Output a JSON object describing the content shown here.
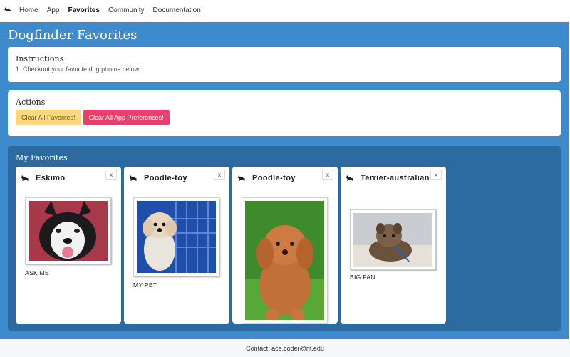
{
  "nav": {
    "logo_icon": "dog-icon",
    "links": [
      "Home",
      "App",
      "Favorites",
      "Community",
      "Documentation"
    ],
    "active": "Favorites"
  },
  "page": {
    "title": "Dogfinder Favorites"
  },
  "instructions": {
    "title": "Instructions",
    "items": [
      "1. Checkout your favorite dog photos below!"
    ]
  },
  "actions": {
    "title": "Actions",
    "clear_favorites": "Clear All Favorites!",
    "clear_preferences": "Clear All App Preferences!"
  },
  "favorites": {
    "title": "My Favorites",
    "close_label": "x",
    "cards": [
      {
        "name": "Eskimo",
        "caption": "ASK ME",
        "icon": "dog-icon"
      },
      {
        "name": "Poodle-toy",
        "caption": "MY PET",
        "icon": "dog-icon"
      },
      {
        "name": "Poodle-toy",
        "caption": "",
        "icon": "dog-icon"
      },
      {
        "name": "Terrier-australian",
        "caption": "BIG FAN",
        "icon": "dog-icon"
      }
    ]
  },
  "footer": {
    "contact": "Contact: ace.coder@rit.edu"
  },
  "colors": {
    "primary_blue": "#3d8bcd",
    "dark_blue": "#2c6aa0",
    "warning": "#fbd77f",
    "danger": "#e2426b"
  }
}
